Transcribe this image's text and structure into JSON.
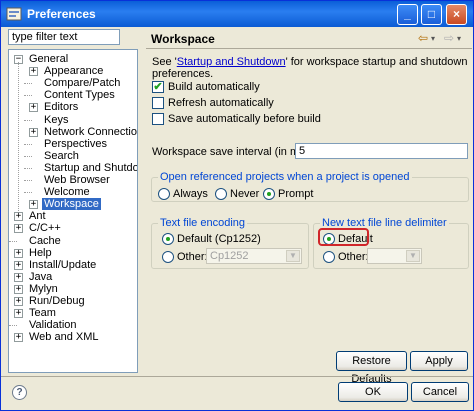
{
  "window": {
    "title": "Preferences",
    "controls": {
      "minimize": "_",
      "maximize": "□",
      "close": "×"
    }
  },
  "filter": {
    "placeholder": "type filter text",
    "value": "type filter text"
  },
  "tree": {
    "items": [
      {
        "label": "General",
        "expander": "−",
        "level": 0
      },
      {
        "label": "Appearance",
        "expander": "+",
        "level": 1
      },
      {
        "label": "Compare/Patch",
        "expander": "",
        "level": 1
      },
      {
        "label": "Content Types",
        "expander": "",
        "level": 1
      },
      {
        "label": "Editors",
        "expander": "+",
        "level": 1
      },
      {
        "label": "Keys",
        "expander": "",
        "level": 1
      },
      {
        "label": "Network Connections",
        "expander": "+",
        "level": 1
      },
      {
        "label": "Perspectives",
        "expander": "",
        "level": 1
      },
      {
        "label": "Search",
        "expander": "",
        "level": 1
      },
      {
        "label": "Startup and Shutdown",
        "expander": "",
        "level": 1
      },
      {
        "label": "Web Browser",
        "expander": "",
        "level": 1
      },
      {
        "label": "Welcome",
        "expander": "",
        "level": 1
      },
      {
        "label": "Workspace",
        "expander": "+",
        "level": 1,
        "selected": true
      },
      {
        "label": "Ant",
        "expander": "+",
        "level": 0
      },
      {
        "label": "C/C++",
        "expander": "+",
        "level": 0
      },
      {
        "label": "Cache",
        "expander": "",
        "level": 0
      },
      {
        "label": "Help",
        "expander": "+",
        "level": 0
      },
      {
        "label": "Install/Update",
        "expander": "+",
        "level": 0
      },
      {
        "label": "Java",
        "expander": "+",
        "level": 0
      },
      {
        "label": "Mylyn",
        "expander": "+",
        "level": 0
      },
      {
        "label": "Run/Debug",
        "expander": "+",
        "level": 0
      },
      {
        "label": "Team",
        "expander": "+",
        "level": 0
      },
      {
        "label": "Validation",
        "expander": "",
        "level": 0
      },
      {
        "label": "Web and XML",
        "expander": "+",
        "level": 0
      }
    ]
  },
  "page": {
    "title": "Workspace",
    "nav_back": "⇦",
    "nav_forward": "⇨",
    "intro_prefix": "See '",
    "intro_link": "Startup and Shutdown",
    "intro_suffix": "' for workspace startup and shutdown preferences.",
    "build_automatically": {
      "label": "Build automatically",
      "checked": true
    },
    "refresh_automatically": {
      "label": "Refresh automatically",
      "checked": false
    },
    "save_before_build": {
      "label": "Save automatically before build",
      "checked": false
    },
    "save_interval": {
      "label": "Workspace save interval (in minutes):",
      "value": "5"
    },
    "open_projects": {
      "legend": "Open referenced projects when a project is opened",
      "options": [
        "Always",
        "Never",
        "Prompt"
      ],
      "selected": "Prompt"
    },
    "encoding": {
      "legend": "Text file encoding",
      "default_label": "Default (Cp1252)",
      "other_label": "Other:",
      "other_value": "Cp1252",
      "selected": "Default"
    },
    "line_delimiter": {
      "legend": "New text file line delimiter",
      "default_label": "Default",
      "other_label": "Other:",
      "other_value": "",
      "selected": "Default"
    },
    "restore_defaults": "Restore Defaults",
    "apply": "Apply"
  },
  "footer": {
    "help": "?",
    "ok": "OK",
    "cancel": "Cancel"
  },
  "colors": {
    "title_bar": "#0a5fd8",
    "selection": "#316ac5",
    "highlight": "#d0262a",
    "check": "#21a121"
  }
}
